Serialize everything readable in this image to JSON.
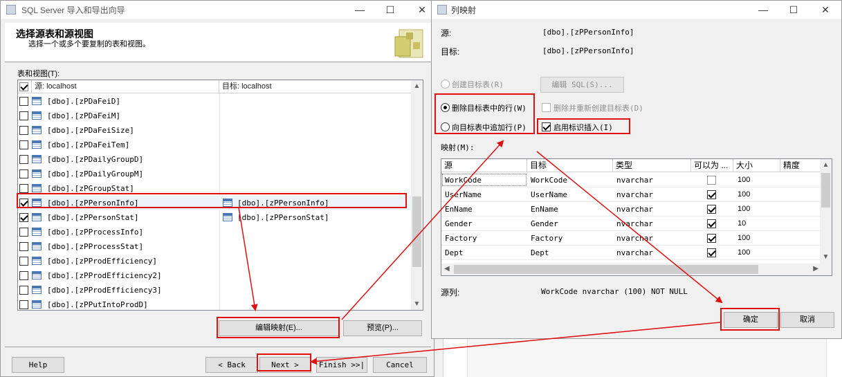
{
  "wizard": {
    "title": "SQL Server 导入和导出向导",
    "controls": [
      "—",
      "☐",
      "✕"
    ],
    "heading": "选择源表和源视图",
    "subheading": "选择一个或多个要复制的表和视图。",
    "tables_label": "表和视图(T):",
    "col_source": "源: localhost",
    "col_dest": "目标: localhost",
    "rows": [
      {
        "src": "[dbo].[zPDaFeiD]",
        "dst": "",
        "checked": false
      },
      {
        "src": "[dbo].[zPDaFeiM]",
        "dst": "",
        "checked": false
      },
      {
        "src": "[dbo].[zPDaFeiSize]",
        "dst": "",
        "checked": false
      },
      {
        "src": "[dbo].[zPDaFeiTem]",
        "dst": "",
        "checked": false
      },
      {
        "src": "[dbo].[zPDailyGroupD]",
        "dst": "",
        "checked": false
      },
      {
        "src": "[dbo].[zPDailyGroupM]",
        "dst": "",
        "checked": false
      },
      {
        "src": "[dbo].[zPGroupStat]",
        "dst": "",
        "checked": false
      },
      {
        "src": "[dbo].[zPPersonInfo]",
        "dst": "[dbo].[zPPersonInfo]",
        "checked": true
      },
      {
        "src": "[dbo].[zPPersonStat]",
        "dst": "[dbo].[zPPersonStat]",
        "checked": true
      },
      {
        "src": "[dbo].[zPProcessInfo]",
        "dst": "",
        "checked": false
      },
      {
        "src": "[dbo].[zPProcessStat]",
        "dst": "",
        "checked": false
      },
      {
        "src": "[dbo].[zPProdEfficiency]",
        "dst": "",
        "checked": false
      },
      {
        "src": "[dbo].[zPProdEfficiency2]",
        "dst": "",
        "checked": false
      },
      {
        "src": "[dbo].[zPProdEfficiency3]",
        "dst": "",
        "checked": false
      },
      {
        "src": "[dbo].[zPPutIntoProdD]",
        "dst": "",
        "checked": false
      }
    ],
    "edit_mapping": "编辑映射(E)...",
    "preview": "预览(P)...",
    "help": "Help",
    "back": "< Back",
    "next": "Next >",
    "finish": "Finish >>|",
    "cancel": "Cancel"
  },
  "mapping": {
    "title": "列映射",
    "source_label": "源:",
    "source_value": "[dbo].[zPPersonInfo]",
    "dest_label": "目标:",
    "dest_value": "[dbo].[zPPersonInfo]",
    "create_table": "创建目标表(R)",
    "edit_sql": "编辑 SQL(S)...",
    "delete_rows": "删除目标表中的行(W)",
    "drop_recreate": "删除并重新创建目标表(D)",
    "append_rows": "向目标表中追加行(P)",
    "enable_identity": "启用标识插入(I)",
    "mappings_label": "映射(M):",
    "columns": [
      "源",
      "目标",
      "类型",
      "可以为 ...",
      "大小",
      "精度"
    ],
    "rows": [
      {
        "src": "WorkCode",
        "dst": "WorkCode",
        "type": "nvarchar",
        "nullable": false,
        "size": "100"
      },
      {
        "src": "UserName",
        "dst": "UserName",
        "type": "nvarchar",
        "nullable": true,
        "size": "100"
      },
      {
        "src": "EnName",
        "dst": "EnName",
        "type": "nvarchar",
        "nullable": true,
        "size": "100"
      },
      {
        "src": "Gender",
        "dst": "Gender",
        "type": "nvarchar",
        "nullable": true,
        "size": "10"
      },
      {
        "src": "Factory",
        "dst": "Factory",
        "type": "nvarchar",
        "nullable": true,
        "size": "100"
      },
      {
        "src": "Dept",
        "dst": "Dept",
        "type": "nvarchar",
        "nullable": true,
        "size": "100"
      }
    ],
    "source_col_label": "源列:",
    "source_col_value": "WorkCode nvarchar (100) NOT NULL",
    "ok": "确定",
    "cancel": "取消"
  },
  "colors": {
    "highlight": "#e01010",
    "selected_row": "#d9e8fb"
  }
}
